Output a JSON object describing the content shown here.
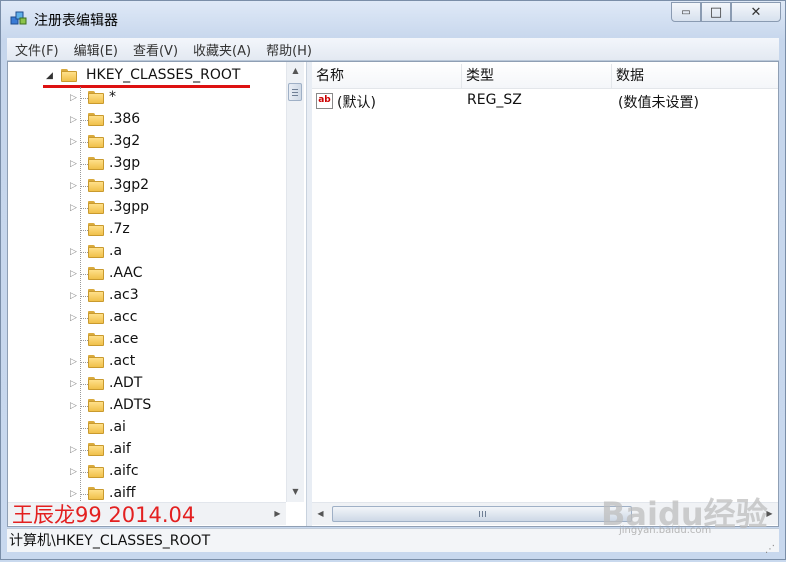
{
  "window": {
    "title": "注册表编辑器",
    "minimize_glyph": "▭",
    "maximize_glyph": "□",
    "close_glyph": "✕"
  },
  "menu": [
    "文件(F)",
    "编辑(E)",
    "查看(V)",
    "收藏夹(A)",
    "帮助(H)"
  ],
  "tree": {
    "root": "HKEY_CLASSES_ROOT",
    "items": [
      {
        "label": "*",
        "expandable": true
      },
      {
        "label": ".386",
        "expandable": true
      },
      {
        "label": ".3g2",
        "expandable": true
      },
      {
        "label": ".3gp",
        "expandable": true
      },
      {
        "label": ".3gp2",
        "expandable": true
      },
      {
        "label": ".3gpp",
        "expandable": true
      },
      {
        "label": ".7z",
        "expandable": false
      },
      {
        "label": ".a",
        "expandable": true
      },
      {
        "label": ".AAC",
        "expandable": true
      },
      {
        "label": ".ac3",
        "expandable": true
      },
      {
        "label": ".acc",
        "expandable": true
      },
      {
        "label": ".ace",
        "expandable": false
      },
      {
        "label": ".act",
        "expandable": true
      },
      {
        "label": ".ADT",
        "expandable": true
      },
      {
        "label": ".ADTS",
        "expandable": true
      },
      {
        "label": ".ai",
        "expandable": false
      },
      {
        "label": ".aif",
        "expandable": true
      },
      {
        "label": ".aifc",
        "expandable": true
      },
      {
        "label": ".aiff",
        "expandable": true
      }
    ]
  },
  "list": {
    "columns": [
      "名称",
      "类型",
      "数据"
    ],
    "rows": [
      {
        "name": "(默认)",
        "type": "REG_SZ",
        "data": "(数值未设置)",
        "icon": "string-value-icon"
      }
    ]
  },
  "overlay_text": "王辰龙99 2014.04",
  "status_path": "计算机\\HKEY_CLASSES_ROOT",
  "watermark": {
    "logo": "Baidu经验",
    "url": "jingyan.baidu.com"
  },
  "colors": {
    "annotation": "#e32020",
    "folder": "#f0c04a"
  }
}
